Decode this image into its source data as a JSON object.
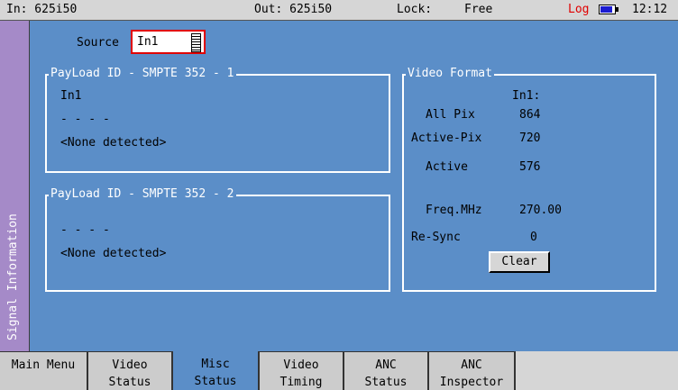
{
  "status": {
    "input": "In: 625i50",
    "output": "Out: 625i50",
    "lock_label": "Lock:",
    "lock_value": "Free",
    "log": "Log",
    "time": "12:12",
    "battery_level": 0.85
  },
  "side_tab": "Signal Information",
  "source": {
    "label": "Source",
    "value": "In1"
  },
  "payload1": {
    "title": "PayLoad ID - SMPTE 352 - 1",
    "input": "In1",
    "dashes": "- - - -",
    "status": "<None detected>"
  },
  "payload2": {
    "title": "PayLoad ID - SMPTE 352 - 2",
    "dashes": "- - - -",
    "status": "<None detected>"
  },
  "video_format": {
    "title": "Video Format",
    "column": "In1:",
    "rows": [
      {
        "label": "All Pix",
        "value": "864"
      },
      {
        "label": "Active-Pix",
        "value": "720"
      },
      {
        "label": "Active",
        "value": "576"
      },
      {
        "label": "Freq.MHz",
        "value": "270.00"
      },
      {
        "label": "Re-Sync",
        "value": "0"
      }
    ],
    "clear_label": "Clear"
  },
  "tabs": [
    {
      "l1": "Main Menu",
      "l2": ""
    },
    {
      "l1": "Video",
      "l2": "Status"
    },
    {
      "l1": "Misc",
      "l2": "Status"
    },
    {
      "l1": "Video",
      "l2": "Timing"
    },
    {
      "l1": "ANC",
      "l2": "Status"
    },
    {
      "l1": "ANC",
      "l2": "Inspector"
    }
  ]
}
